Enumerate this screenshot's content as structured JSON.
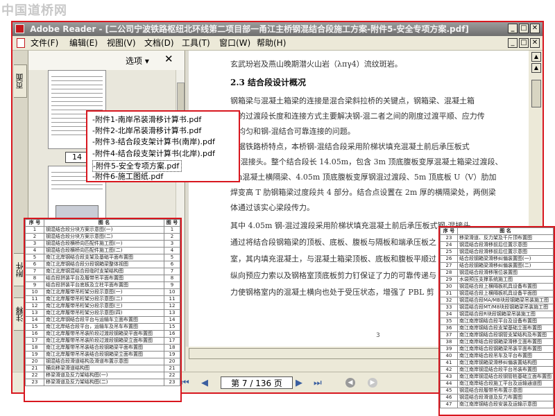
{
  "watermark": "中国道桥网",
  "window": {
    "title": "Adobe Reader - [二公司宁波铁路枢纽北环线第二项目部一甬江主桥钢混结合段施工方案-附件5-安全专项方案.pdf]",
    "btn_min": "_",
    "btn_max": "□",
    "btn_close": "✕"
  },
  "menu": {
    "file": "文件(F)",
    "edit": "编辑(E)",
    "view": "视图(V)",
    "document": "文档(D)",
    "tools": "工具(T)",
    "window": "窗口(W)",
    "help": "帮助(H)"
  },
  "sidebar": {
    "tab_pages": "页面",
    "tab_attach": "附件",
    "tab_comments": "注释"
  },
  "panel": {
    "options_label": "选项 ▾",
    "close_glyph": "✕",
    "page_label": "14"
  },
  "attachments": [
    "-附件1-南岸吊装滑移计算书.pdf",
    "-附件2-北岸吊装滑移计算书.pdf",
    "-附件3-结合段支架计算书(南岸).pdf",
    "-附件4-结合段支架计算书(北岸).pdf",
    "-附件5-安全专项方案.pdf",
    "-附件6-施工图纸.pdf"
  ],
  "doc": {
    "line0": "玄武玢岩及燕山晚期潜火山岩（λπγ4）流纹斑岩。",
    "heading": "2.3  结合段设计概况",
    "p1": [
      "    钢箱梁与混凝土箱梁的连接是混合梁斜拉桥的关键点，钢箱梁、混凝土箱",
      "梁的过渡段长度和连接方式主要解决钢-混二者之间的刚度过渡平顺、应力传",
      "递均匀和钢-混结合可靠连接的问题。",
      "    根据铁路桥特点，本桥钢-混结合段采用阶梯状填充混凝土前后承压板式",
      "钢-混接头。整个结合段长 14.05m，包含 3m 顶底腹板变厚混凝土箱梁过渡段、",
      "6m混凝土横隔梁、4.05m 顶底腹板变厚钢混过渡段、5m 顶底板 U（V）肋加",
      "焊变高 T 肋钢箱梁过度段共 4 部分。结合点设置在 2m 厚的横隔梁处，两侧梁",
      "体通过该实心梁段传力。"
    ],
    "p2": [
      "    其中 4.05m 钢-混过渡段采用阶梯状填充混凝土前后承压板式钢-混接头，",
      "通过将结合段钢箱梁的顶板、底板、腹板与隔板和端承压板之",
      "室，其内填充混凝土，与混凝土箱梁顶板、底板和腹板平顺过",
      "纵向预应力索以及钢格室顶底板剪力钉保证了力的可靠传递与",
      "力使钢格室内的混凝土横向也处于受压状态，增强了 PBL 剪"
    ],
    "page_number": "3"
  },
  "nav": {
    "page_display": "第 7 / 136 页"
  },
  "table_left": {
    "headers": [
      "序 号",
      "图 名",
      "图 号"
    ],
    "rows": [
      [
        "1",
        "钢混结合段分块方案示意图(一)",
        "1"
      ],
      [
        "2",
        "钢混结合段分块方案示意图(二)",
        "2"
      ],
      [
        "3",
        "钢混结合段横桥向匹配件施工图(一)",
        "3"
      ],
      [
        "4",
        "钢混结合段横桥向匹配件施工图(二)",
        "4"
      ],
      [
        "5",
        "南江北岸钢结合段支架及基础平面布置图",
        "5"
      ],
      [
        "6",
        "南江北岸钢结合段分段钢箱梁整体视图",
        "6"
      ],
      [
        "7",
        "南江北岸钢混结合段临时支架结构图",
        "7"
      ],
      [
        "8",
        "结合段拼装平台及履带吊平面布置图",
        "8"
      ],
      [
        "9",
        "结合段拼装平台底板及立柱平面布置图",
        "9"
      ],
      [
        "10",
        "南江北岸履带吊桁架分段示意图(一)",
        "10"
      ],
      [
        "11",
        "南江北岸履带吊桁架分段示意图(二)",
        "11"
      ],
      [
        "12",
        "南江北岸履带吊桁架分段示意图(三)",
        "12"
      ],
      [
        "13",
        "南江北岸履带吊桁架分段示意图(四)",
        "13"
      ],
      [
        "14",
        "南江北岸钢结合段平台与运输车立面布置图",
        "14"
      ],
      [
        "15",
        "南江北岸结合段平台，运输车及吊车布置图",
        "15"
      ],
      [
        "16",
        "南江北岸履带吊吊装阶段过渡段钢箱梁平面布置图",
        "16"
      ],
      [
        "17",
        "南江北岸履带吊吊装阶段过渡段钢箱梁立面布置图",
        "17"
      ],
      [
        "18",
        "南江北岸履带吊吊装结合段钢箱梁平面布置图",
        "18"
      ],
      [
        "19",
        "南江北岸履带吊吊装结合段钢箱梁立面布置图",
        "19"
      ],
      [
        "20",
        "钢混结合段滑道结构及滑道布置示意图",
        "20"
      ],
      [
        "21",
        "横向移梁滑道结构图",
        "21"
      ],
      [
        "22",
        "移梁滑道及反力架结构图(一)",
        "22"
      ],
      [
        "23",
        "移梁滑道及反力架结构图(二)",
        "23"
      ]
    ]
  },
  "table_right": {
    "headers": [
      "序 号",
      "图 名"
    ],
    "rows": [
      [
        "23",
        "移梁滑道、反力架及千斤顶布置图"
      ],
      [
        "24",
        "钢混结合段滑移前后位置示意图"
      ],
      [
        "25",
        "钢混结合段滑移前后位置示意图"
      ],
      [
        "26",
        "结合段钢箱梁滑移纠偏装置图(一)"
      ],
      [
        "27",
        "结合段钢箱梁滑移纠偏装置图(二)"
      ],
      [
        "28",
        "钢混结合段滑移限位装置图"
      ],
      [
        "29",
        "水袋预压支撑系统施工图"
      ],
      [
        "30",
        "钢混结合段上横隔板机具设备布置图"
      ],
      [
        "31",
        "钢混结合段上横隔板机具设备平面图"
      ],
      [
        "32",
        "钢混结合段MA/MB块段钢箱梁吊装施工图"
      ],
      [
        "33",
        "钢混结合段MT/M8块段钢箱梁吊装施工图"
      ],
      [
        "34",
        "钢混结合段R块段钢箱梁吊装施工图"
      ],
      [
        "35",
        "南江南岸钢结合段平台及设备布置图"
      ],
      [
        "36",
        "南江南岸钢结合段支架基础立面布置图"
      ],
      [
        "37",
        "南江南岸钢结合段钢管支架结构及布置图"
      ],
      [
        "38",
        "南江南岸结合段钢箱梁滑移立面布置图"
      ],
      [
        "39",
        "南江南岸结合段钢箱梁吊装平面布置图"
      ],
      [
        "40",
        "南江南岸结合段吊车及平台布置图"
      ],
      [
        "41",
        "南江南岸钢箱梁滑移纠偏装置结构图"
      ],
      [
        "42",
        "南江南岸钢混结合段平台吊装布置图"
      ],
      [
        "43",
        "南江南岸钢混结合段钢管桩基础立面布置图"
      ],
      [
        "44",
        "南江南岸结合段施工平台及运输通道图"
      ],
      [
        "45",
        "钢混结合段履带吊布置示意图"
      ],
      [
        "46",
        "钢混结合段滑道及反力布置图"
      ],
      [
        "47",
        "南江南岸钢结合段安装及运输示意图"
      ]
    ]
  }
}
